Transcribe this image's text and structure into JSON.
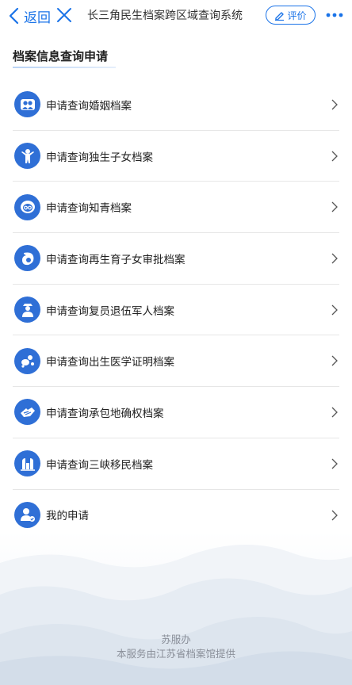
{
  "navbar": {
    "back_label": "返回",
    "title": "长三角民生档案跨区域查询系统",
    "rate_label": "评价"
  },
  "section": {
    "title": "档案信息查询申请"
  },
  "items": [
    {
      "label": "申请查询婚姻档案",
      "icon": "couple-icon"
    },
    {
      "label": "申请查询独生子女档案",
      "icon": "child-icon"
    },
    {
      "label": "申请查询知青档案",
      "icon": "youth-icon"
    },
    {
      "label": "申请查询再生育子女审批档案",
      "icon": "mother-icon"
    },
    {
      "label": "申请查询复员退伍军人档案",
      "icon": "soldier-icon"
    },
    {
      "label": "申请查询出生医学证明档案",
      "icon": "baby-icon"
    },
    {
      "label": "申请查询承包地确权档案",
      "icon": "farmland-icon"
    },
    {
      "label": "申请查询三峡移民档案",
      "icon": "dam-icon"
    },
    {
      "label": "我的申请",
      "icon": "user-check-icon"
    }
  ],
  "footer": {
    "line1": "苏服办",
    "line2": "本服务由江苏省档案馆提供"
  },
  "colors": {
    "accent": "#1a73e8",
    "icon_bg": "#2f6fd6"
  }
}
